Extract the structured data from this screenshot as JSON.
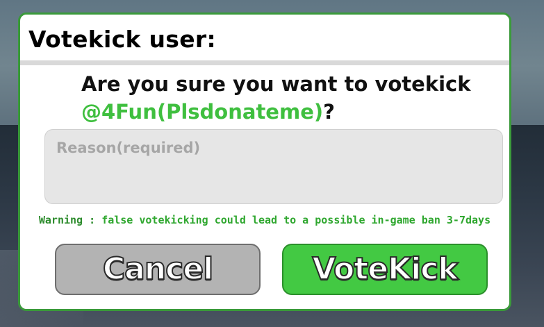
{
  "dialog": {
    "title": "Votekick user:",
    "question_prefix": "Are you sure you want to votekick",
    "target_username": "@4Fun(Plsdonateme)",
    "question_suffix": "?",
    "reason": {
      "value": "",
      "placeholder": "Reason(required)"
    },
    "warning_label": "Warning :",
    "warning_text": "false votekicking could lead to a possible in-game ban 3-7days",
    "cancel_label": "Cancel",
    "votekick_label": "VoteKick"
  },
  "colors": {
    "accent_green": "#43c943",
    "username_green": "#3fbf3f",
    "cancel_gray": "#b3b3b3",
    "border_green": "#3a9a3a"
  }
}
